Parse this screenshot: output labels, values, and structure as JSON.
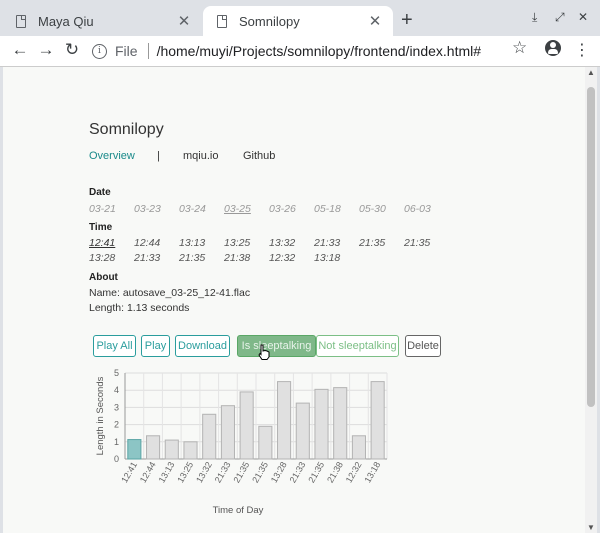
{
  "browser": {
    "tabs": [
      {
        "title": "Maya Qiu",
        "active": false
      },
      {
        "title": "Somnilopy",
        "active": true
      }
    ],
    "url_scheme_label": "File",
    "url": "/home/muyi/Projects/somnilopy/frontend/index.html#"
  },
  "page": {
    "title": "Somnilopy",
    "nav": {
      "overview": "Overview",
      "separator": "|",
      "mqiu": "mqiu.io",
      "github": "Github"
    },
    "date_label": "Date",
    "dates": [
      "03-21",
      "03-23",
      "03-24",
      "03-25",
      "03-26",
      "05-18",
      "05-30",
      "06-03"
    ],
    "selected_date": "03-25",
    "time_label": "Time",
    "times_row1": [
      "12:41",
      "12:44",
      "13:13",
      "13:25",
      "13:32",
      "21:33",
      "21:35",
      "21:35"
    ],
    "times_row2": [
      "13:28",
      "21:33",
      "21:35",
      "21:38",
      "12:32",
      "13:18"
    ],
    "selected_time": "12:41",
    "about_label": "About",
    "about_name": "Name: autosave_03-25_12-41.flac",
    "about_length": "Length: 1.13 seconds",
    "buttons": {
      "play_all": "Play All",
      "play": "Play",
      "download": "Download",
      "is_sleeptalking": "Is sleeptalking",
      "not_sleeptalking": "Not sleeptalking",
      "delete": "Delete"
    }
  },
  "chart_data": {
    "type": "bar",
    "categories": [
      "12:41",
      "12:44",
      "13:13",
      "13:25",
      "13:32",
      "21:33",
      "21:35",
      "21:35",
      "13:28",
      "21:33",
      "21:35",
      "21:38",
      "12:32",
      "13:18"
    ],
    "values": [
      1.13,
      1.35,
      1.1,
      1.0,
      2.6,
      3.1,
      3.9,
      1.9,
      4.5,
      3.25,
      4.05,
      4.15,
      1.35,
      4.5
    ],
    "highlighted_index": 0,
    "xlabel": "Time of Day",
    "ylabel": "Length in Seconds",
    "ylim": [
      0,
      5
    ],
    "yticks": [
      0,
      1,
      2,
      3,
      4,
      5
    ],
    "grid": true,
    "colors": {
      "bar": "#e0e0e0",
      "bar_border": "#b3b3b3",
      "highlight": "#8cc5c5",
      "highlight_border": "#5aa5a5"
    }
  }
}
